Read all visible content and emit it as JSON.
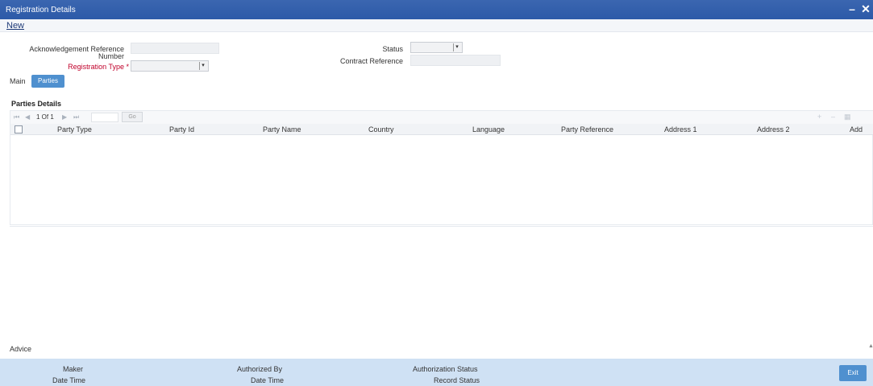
{
  "window": {
    "title": "Registration Details",
    "minimize_label": "–",
    "close_label": "✕"
  },
  "toolbar": {
    "new_label": "New"
  },
  "form": {
    "ack_ref_label_line1": "Acknowledgement Reference",
    "ack_ref_label_line2": "Number",
    "ack_ref_value": "",
    "registration_type_label": "Registration Type *",
    "registration_type_value": "",
    "status_label": "Status",
    "status_value": "",
    "contract_reference_label": "Contract Reference",
    "contract_reference_value": ""
  },
  "tabs": [
    {
      "label": "Main",
      "active": false
    },
    {
      "label": "Parties",
      "active": true
    }
  ],
  "parties": {
    "section_title": "Parties Details",
    "pager": {
      "first_icon": "first-page-icon",
      "prev_icon": "prev-page-icon",
      "page_text": "1 Of 1",
      "next_icon": "next-page-icon",
      "last_icon": "last-page-icon",
      "go_label": "Go"
    },
    "columns": [
      "Party Type",
      "Party Id",
      "Party Name",
      "Country",
      "Language",
      "Party Reference",
      "Address 1",
      "Address 2",
      "Add"
    ],
    "rows": []
  },
  "advice": {
    "label": "Advice"
  },
  "footer": {
    "maker_label": "Maker",
    "maker_datetime_label": "Date Time",
    "authorized_by_label": "Authorized By",
    "authorized_datetime_label": "Date Time",
    "authorization_status_label": "Authorization Status",
    "record_status_label": "Record Status",
    "exit_label": "Exit"
  },
  "colors": {
    "titlebar": "#2c5aa8",
    "accent": "#4f90cf",
    "footer": "#cfe1f4",
    "required": "#c0002a"
  }
}
